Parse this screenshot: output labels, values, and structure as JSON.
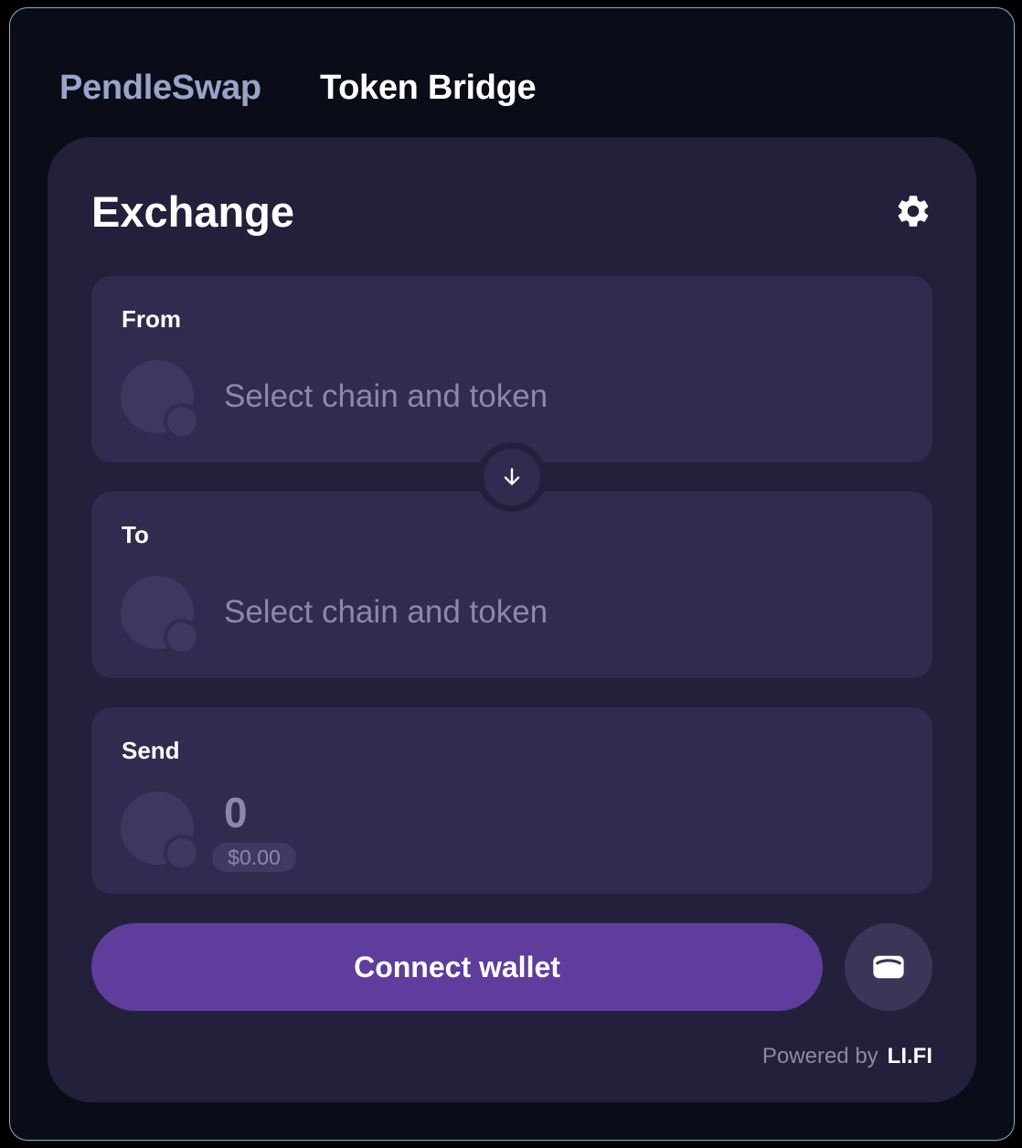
{
  "nav": {
    "tabs": [
      {
        "label": "PendleSwap",
        "active": false
      },
      {
        "label": "Token Bridge",
        "active": true
      }
    ]
  },
  "card": {
    "title": "Exchange",
    "settings_icon": "gear-icon"
  },
  "from": {
    "label": "From",
    "placeholder": "Select chain and token"
  },
  "swap": {
    "icon": "arrow-down-icon"
  },
  "to": {
    "label": "To",
    "placeholder": "Select chain and token"
  },
  "send": {
    "label": "Send",
    "amount": "0",
    "usd_value": "$0.00"
  },
  "actions": {
    "connect_label": "Connect wallet",
    "wallet_icon": "wallet-icon"
  },
  "footer": {
    "powered_by": "Powered by",
    "brand": "LI.FI"
  },
  "colors": {
    "background": "#0a0d18",
    "card": "#22203a",
    "panel": "#312c4f",
    "accent": "#5e3d9c",
    "muted_text": "#8d88a8"
  }
}
